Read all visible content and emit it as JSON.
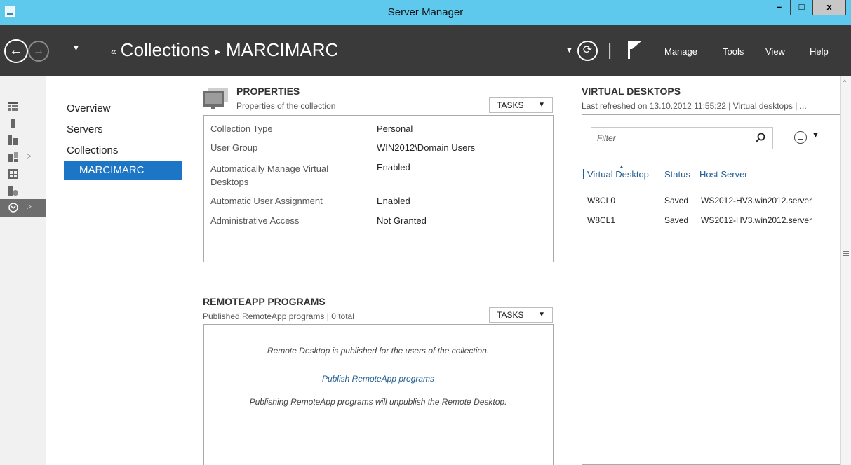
{
  "window": {
    "title": "Server Manager",
    "min_label": "–",
    "max_label": "□",
    "close_label": "x"
  },
  "navbar": {
    "breadcrumb_prefix": "«",
    "breadcrumb_parent": "Collections",
    "breadcrumb_sep": "▸",
    "breadcrumb_current": "MARCIMARC",
    "menus": [
      "Manage",
      "Tools",
      "View",
      "Help"
    ],
    "refresh_icon": "refresh-icon",
    "flag_icon": "notifications-flag-icon"
  },
  "sidebar_nav": {
    "items": [
      "Overview",
      "Servers",
      "Collections"
    ],
    "selected": "MARCIMARC"
  },
  "properties": {
    "title": "PROPERTIES",
    "subtitle": "Properties of the collection",
    "tasks_label": "TASKS",
    "rows": [
      {
        "label": "Collection Type",
        "value": "Personal"
      },
      {
        "label": "User Group",
        "value": "WIN2012\\Domain Users"
      },
      {
        "label": "Automatically Manage Virtual Desktops",
        "value": "Enabled"
      },
      {
        "label": "Automatic User Assignment",
        "value": "Enabled"
      },
      {
        "label": "Administrative Access",
        "value": "Not Granted"
      }
    ]
  },
  "remoteapp": {
    "title": "REMOTEAPP PROGRAMS",
    "subtitle": "Published RemoteApp programs | 0 total",
    "tasks_label": "TASKS",
    "line1": "Remote Desktop is published for the users of the collection.",
    "link": "Publish RemoteApp programs",
    "line2": "Publishing RemoteApp programs will unpublish the Remote Desktop."
  },
  "virtual_desktops": {
    "title": "VIRTUAL DESKTOPS",
    "subtitle": "Last refreshed on 13.10.2012 11:55:22 | Virtual desktops | ...",
    "filter_placeholder": "Filter",
    "columns": [
      "Virtual Desktop",
      "Status",
      "Host Server"
    ],
    "rows": [
      {
        "name": "W8CL0",
        "status": "Saved",
        "host": "WS2012-HV3.win2012.server"
      },
      {
        "name": "W8CL1",
        "status": "Saved",
        "host": "WS2012-HV3.win2012.server"
      }
    ]
  }
}
